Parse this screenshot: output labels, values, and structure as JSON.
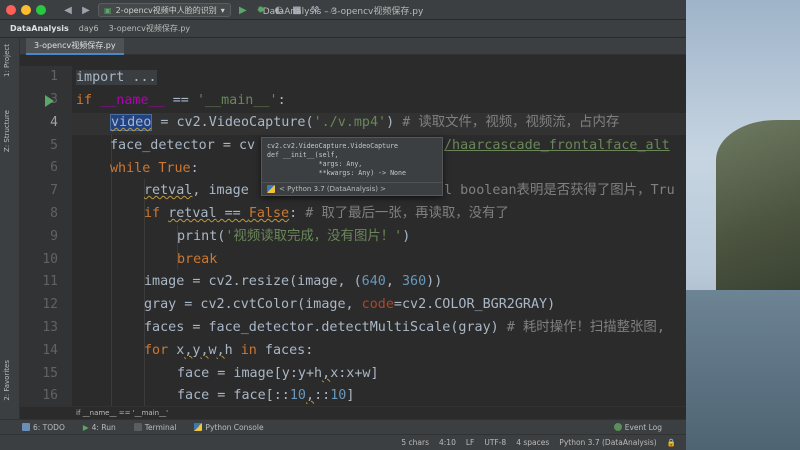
{
  "window": {
    "title": "DataAnalysis – 3-opencv视频保存.py",
    "run_config": "2-opencv视频中人脸的识别"
  },
  "navbar": {
    "project": "DataAnalysis",
    "folder": "day6",
    "file": "3-opencv视频保存.py"
  },
  "editor_tab": "3-opencv视频保存.py",
  "side_tabs": {
    "project": "1: Project",
    "structure": "Z: Structure",
    "favorites": "2: Favorites"
  },
  "line_numbers": [
    "1",
    "3",
    "4",
    "5",
    "6",
    "7",
    "8",
    "9",
    "10",
    "11",
    "12",
    "13",
    "14",
    "15",
    "16"
  ],
  "code": {
    "l1_fold": "import ...",
    "l3_if": "if",
    "l3_name": "__name__",
    "l3_eq": " == ",
    "l3_str": "'__main__'",
    "l3_colon": ":",
    "l4_var": "video",
    "l4_mid": " = cv2.VideoCapture(",
    "l4_str": "'./v.mp4'",
    "l4_end": ")",
    "l4_cmt": " # 读取文件，视频，视频流，占内存",
    "l5_a": "face_detector = cv",
    "l5_str": "/haarcascade_frontalface_alt",
    "l6_kw": "while",
    "l6_true": " True",
    "l6_colon": ":",
    "l7_a": "retval",
    "l7_b": ", image",
    "l7_cmt": "l boolean表明是否获得了图片，Tru",
    "l8_kw": "if",
    "l8_a": "retval",
    "l8_eq": " == ",
    "l8_false": "False",
    "l8_colon": ":",
    "l8_cmt": " # 取了最后一张，再读取，没有了",
    "l9_a": "print(",
    "l9_str": "'视频读取完成，没有图片！'",
    "l9_b": ")",
    "l10_kw": "break",
    "l11_a": "image = cv2.resize(image, (",
    "l11_n1": "640",
    "l11_c": ", ",
    "l11_n2": "360",
    "l11_b": "))",
    "l12_a": "gray = cv2.cvtColor(image, ",
    "l12_param": "code",
    "l12_b": "=cv2.COLOR_BGR2GRAY)",
    "l13_a": "faces = face_detector.detectMultiScale(gray)",
    "l13_cmt": " # 耗时操作！扫描整张图,",
    "l14_kw": "for",
    "l14_a": " x",
    "l14_b": ",",
    "l14_c": "y",
    "l14_d": ",",
    "l14_e": "w",
    "l14_f": ",",
    "l14_g": "h",
    "l14_in": " in",
    "l14_h": " faces:",
    "l15_a": "face = image[y:y+h",
    "l15_b": ",",
    "l15_c": "x:x+w]",
    "l16_a": "face = face[::",
    "l16_n1": "10",
    "l16_b": ",",
    "l16_c": "::",
    "l16_n2": "10",
    "l16_d": "]"
  },
  "popup": {
    "l1": "cv2.cv2.VideoCapture.VideoCapture",
    "l2": "def __init__(self,",
    "l3": "             *args: Any,",
    "l4": "             **kwargs: Any) -> None",
    "foot": "< Python 3.7 (DataAnalysis) >"
  },
  "breadcrumb": "if __name__ == '__main__'",
  "bottom_tabs": [
    "6: TODO",
    "4: Run",
    "Terminal",
    "Python Console"
  ],
  "event_log": "Event Log",
  "status": {
    "chars": "5 chars",
    "pos": "4:10",
    "lf": "LF",
    "enc": "UTF-8",
    "indent": "4 spaces",
    "interp": "Python 3.7 (DataAnalysis)"
  },
  "colors": {
    "keyword": "#cc7832",
    "string": "#6a8759",
    "number": "#6897bb",
    "comment": "#808080",
    "magic": "#b200b2",
    "background": "#2b2b2b"
  }
}
